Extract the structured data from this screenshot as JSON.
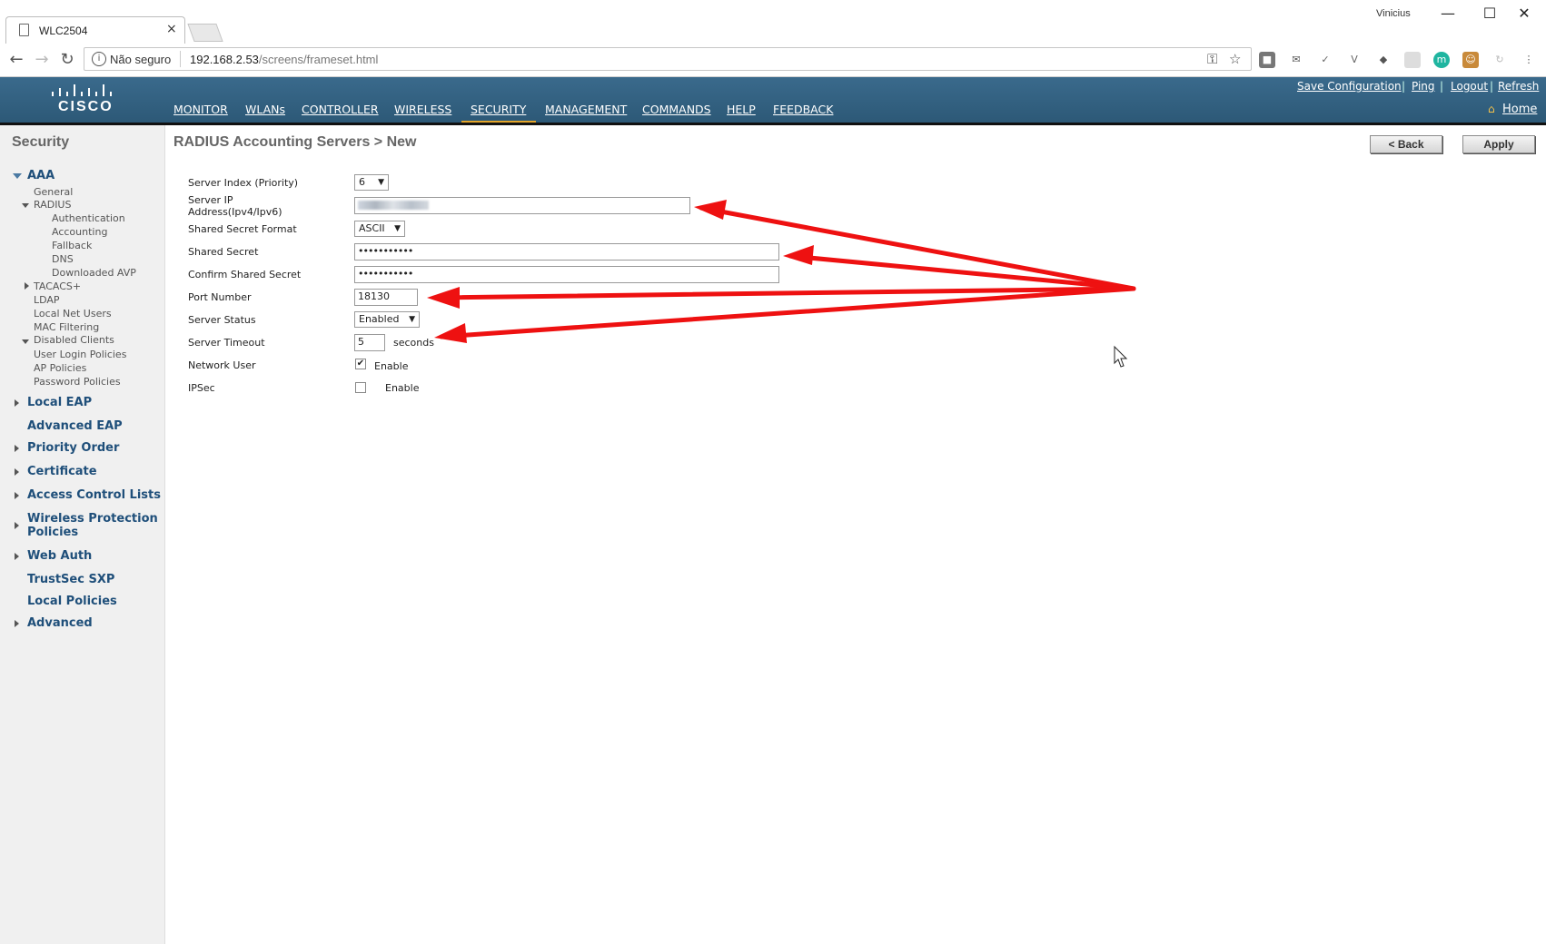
{
  "browser": {
    "tab_title": "WLC2504",
    "tab_close": "×",
    "user": "Vinicius",
    "win_min": "—",
    "win_max": "☐",
    "win_close": "✕",
    "not_secure": "Não seguro",
    "url_host": "192.168.2.53",
    "url_path": "/screens/frameset.html"
  },
  "cisco": {
    "logo_text": "CISCO",
    "menu": [
      "MONITOR",
      "WLANs",
      "CONTROLLER",
      "WIRELESS",
      "SECURITY",
      "MANAGEMENT",
      "COMMANDS",
      "HELP",
      "FEEDBACK"
    ],
    "active_menu": "SECURITY",
    "top_links": [
      "Save Configuration",
      "Ping",
      "Logout",
      "Refresh"
    ],
    "home": "Home"
  },
  "sidebar": {
    "title": "Security",
    "aaa": "AAA",
    "aaa_items": [
      "General",
      "RADIUS"
    ],
    "radius_items": [
      "Authentication",
      "Accounting",
      "Fallback",
      "DNS",
      "Downloaded AVP"
    ],
    "aaa_items2": [
      "TACACS+",
      "LDAP",
      "Local Net Users",
      "MAC Filtering",
      "Disabled Clients",
      "User Login Policies",
      "AP Policies",
      "Password Policies"
    ],
    "sections": [
      "Local EAP",
      "Advanced EAP",
      "Priority Order",
      "Certificate",
      "Access Control Lists",
      "Wireless Protection",
      "Policies",
      "Web Auth",
      "TrustSec SXP",
      "Local Policies",
      "Advanced"
    ]
  },
  "content": {
    "title": "RADIUS Accounting Servers > New",
    "back_button": "< Back",
    "apply_button": "Apply",
    "labels": {
      "server_index": "Server Index (Priority)",
      "server_ip_1": "Server IP",
      "server_ip_2": "Address(Ipv4/Ipv6)",
      "secret_format": "Shared Secret Format",
      "shared_secret": "Shared Secret",
      "confirm_secret": "Confirm Shared Secret",
      "port": "Port Number",
      "status": "Server Status",
      "timeout": "Server Timeout",
      "network_user": "Network User",
      "ipsec": "IPSec"
    },
    "values": {
      "server_index": "6",
      "secret_format": "ASCII",
      "shared_secret": "•••••••••••",
      "confirm_secret": "•••••••••••",
      "port": "18130",
      "status": "Enabled",
      "timeout": "5",
      "timeout_unit": "seconds",
      "network_user_enable": "Enable",
      "network_user_checked": true,
      "ipsec_enable": "Enable",
      "ipsec_checked": false
    }
  },
  "colors": {
    "cisco_header": "#2f5e7e",
    "active_underline": "#e3a52b",
    "sidebar_link": "#1f4f7a",
    "annotation_arrow": "#ee1111"
  }
}
